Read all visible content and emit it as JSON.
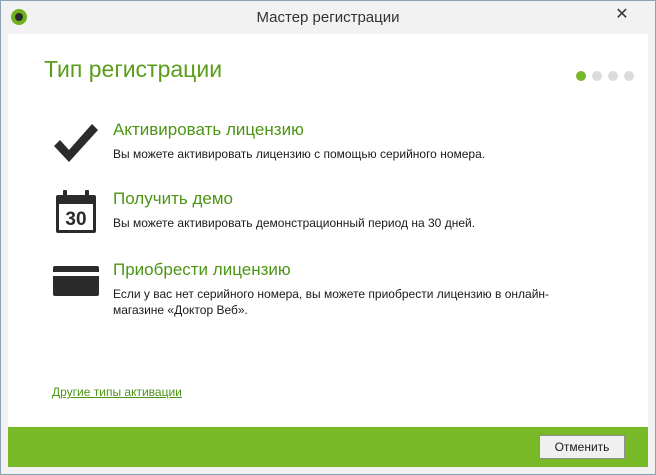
{
  "window": {
    "title": "Мастер регистрации",
    "close_glyph": "✕"
  },
  "page": {
    "title": "Тип регистрации",
    "steps": {
      "total": 4,
      "active": 1
    }
  },
  "options": [
    {
      "icon": "checkmark-icon",
      "title": "Активировать лицензию",
      "description": "Вы можете активировать лицензию с помощью серийного номера."
    },
    {
      "icon": "calendar-icon",
      "calendar_number": "30",
      "title": "Получить демо",
      "description": "Вы можете активировать демонстрационный период на 30 дней."
    },
    {
      "icon": "credit-card-icon",
      "title": "Приобрести лицензию",
      "description": "Если у вас нет серийного номера, вы можете приобрести лицензию в онлайн-магазине «Доктор Веб»."
    }
  ],
  "links": {
    "other_activation": "Другие типы активации"
  },
  "footer": {
    "cancel_label": "Отменить"
  },
  "colors": {
    "accent_green": "#78b928",
    "title_green": "#5a9d1a",
    "step_inactive": "#dcdcdc"
  }
}
